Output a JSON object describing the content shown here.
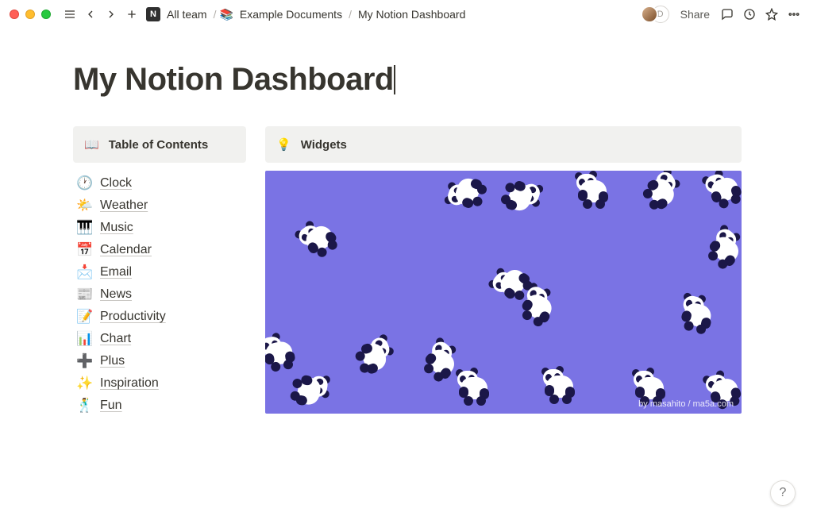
{
  "breadcrumb": {
    "workspace": "All team",
    "doc1_emoji": "📚",
    "doc1": "Example Documents",
    "doc2": "My Notion Dashboard"
  },
  "share_label": "Share",
  "page": {
    "title": "My Notion Dashboard",
    "toc_heading_emoji": "📖",
    "toc_heading": "Table of Contents",
    "widgets_heading_emoji": "💡",
    "widgets_heading": "Widgets",
    "widget_credit": "by masahito / ma5a.com"
  },
  "toc": [
    {
      "emoji": "🕐",
      "label": "Clock"
    },
    {
      "emoji": "🌤️",
      "label": "Weather"
    },
    {
      "emoji": "🎹",
      "label": "Music"
    },
    {
      "emoji": "📅",
      "label": "Calendar"
    },
    {
      "emoji": "📩",
      "label": "Email"
    },
    {
      "emoji": "📰",
      "label": "News"
    },
    {
      "emoji": "📝",
      "label": "Productivity"
    },
    {
      "emoji": "📊",
      "label": "Chart"
    },
    {
      "emoji": "➕",
      "label": "Plus"
    },
    {
      "emoji": "✨",
      "label": "Inspiration"
    },
    {
      "emoji": "🕺",
      "label": "Fun"
    }
  ],
  "help_label": "?"
}
